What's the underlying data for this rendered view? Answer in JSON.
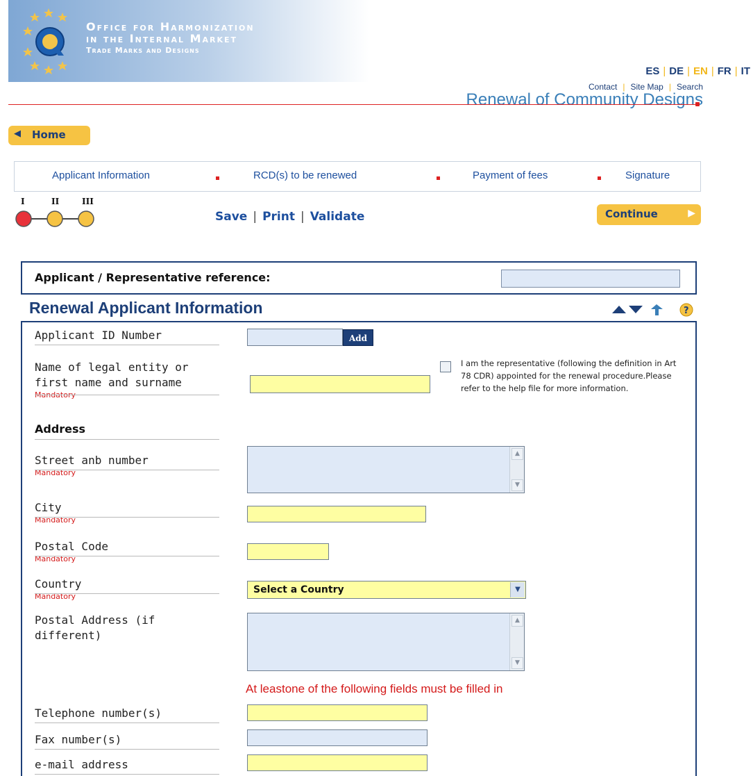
{
  "header": {
    "org_line1": "Office for Harmonization",
    "org_line2": "in the Internal Market",
    "org_line3": "Trade Marks and Designs",
    "languages": [
      "ES",
      "DE",
      "EN",
      "FR",
      "IT"
    ],
    "active_language": "EN",
    "links": [
      "Contact",
      "Site Map",
      "Search"
    ],
    "page_title": "Renewal of Community Designs"
  },
  "nav": {
    "home_label": "Home",
    "steps": [
      "Applicant Information",
      "RCD(s) to be renewed",
      "Payment of fees",
      "Signature"
    ],
    "roman": [
      "I",
      "II",
      "III"
    ],
    "actions": [
      "Save",
      "Print",
      "Validate"
    ],
    "continue_label": "Continue"
  },
  "reference": {
    "label": "Applicant / Representative reference:",
    "value": ""
  },
  "section": {
    "title": "Renewal Applicant Information",
    "mandatory_text": "Mandatory",
    "applicant_id_label": "Applicant ID Number",
    "add_label": "Add",
    "name_label_1": "Name of legal entity or",
    "name_label_2": "first name and surname",
    "representative_text": "I am the representative (following the definition in Art 78 CDR) appointed for the renewal procedure.Please refer to the help file for more information.",
    "address_heading": "Address",
    "street_label": "Street anb number",
    "city_label": "City",
    "postal_code_label": "Postal Code",
    "country_label": "Country",
    "country_value": "Select a Country",
    "postal_address_label_1": "Postal Address (if",
    "postal_address_label_2": "different)",
    "warning": "At leastone of the following fields must be filled in",
    "telephone_label": "Telephone number(s)",
    "fax_label": "Fax number(s)",
    "email_label": "e-mail address"
  },
  "colors": {
    "navy": "#1d3f78",
    "link_blue": "#1d4f9e",
    "required_yellow": "#fefea2",
    "optional_blue": "#dfe9f7",
    "alert_red": "#d41a1a",
    "accent_gold": "#f6c343"
  }
}
